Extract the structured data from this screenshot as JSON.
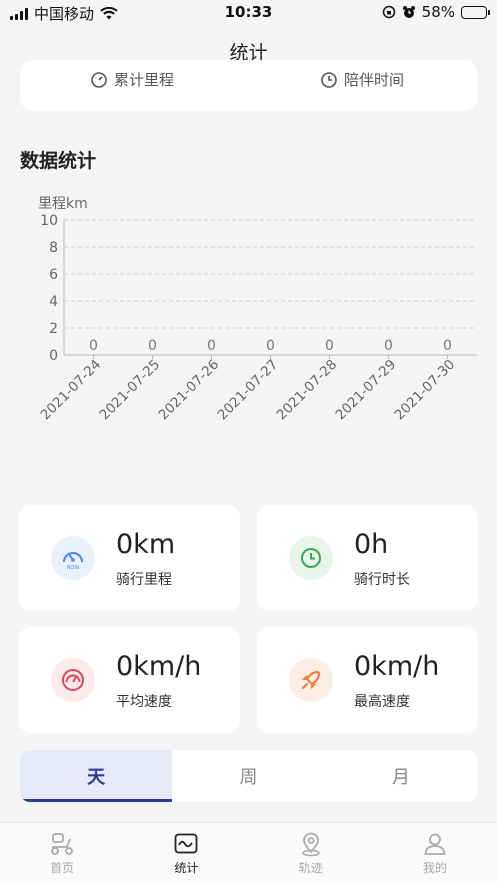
{
  "status_bar": {
    "carrier": "中国移动",
    "time": "10:33",
    "battery_percent": "58%",
    "battery_level": 0.58
  },
  "nav": {
    "title": "统计"
  },
  "summary": {
    "total_distance_label": "累计里程",
    "companion_time_label": "陪伴时间"
  },
  "section": {
    "title": "数据统计"
  },
  "chart_data": {
    "type": "bar",
    "ylabel": "里程km",
    "ylim": [
      0,
      10
    ],
    "yticks": [
      "10",
      "8",
      "6",
      "4",
      "2",
      "0"
    ],
    "categories": [
      "2021-07-24",
      "2021-07-25",
      "2021-07-26",
      "2021-07-27",
      "2021-07-28",
      "2021-07-29",
      "2021-07-30"
    ],
    "values": [
      0,
      0,
      0,
      0,
      0,
      0,
      0
    ],
    "data_labels": [
      "0",
      "0",
      "0",
      "0",
      "0",
      "0",
      "0"
    ],
    "grid": true
  },
  "stats": [
    {
      "value": "0km",
      "label": "骑行里程",
      "icon": "speedometer-icon",
      "color": "#4a8af4",
      "bg": "#eaf1fd"
    },
    {
      "value": "0h",
      "label": "骑行时长",
      "icon": "clock-icon",
      "color": "#3aa757",
      "bg": "#e8f5ec"
    },
    {
      "value": "0km/h",
      "label": "平均速度",
      "icon": "gauge-icon",
      "color": "#e0455a",
      "bg": "#fce9ec"
    },
    {
      "value": "0km/h",
      "label": "最高速度",
      "icon": "rocket-icon",
      "color": "#ef7a3b",
      "bg": "#fdeee5"
    }
  ],
  "period_tabs": [
    {
      "label": "天",
      "active": true
    },
    {
      "label": "周",
      "active": false
    },
    {
      "label": "月",
      "active": false
    }
  ],
  "tabbar": [
    {
      "label": "首页",
      "icon": "scooter-icon",
      "active": false
    },
    {
      "label": "统计",
      "icon": "chart-icon",
      "active": true
    },
    {
      "label": "轨迹",
      "icon": "location-pin-icon",
      "active": false
    },
    {
      "label": "我的",
      "icon": "user-icon",
      "active": false
    }
  ]
}
